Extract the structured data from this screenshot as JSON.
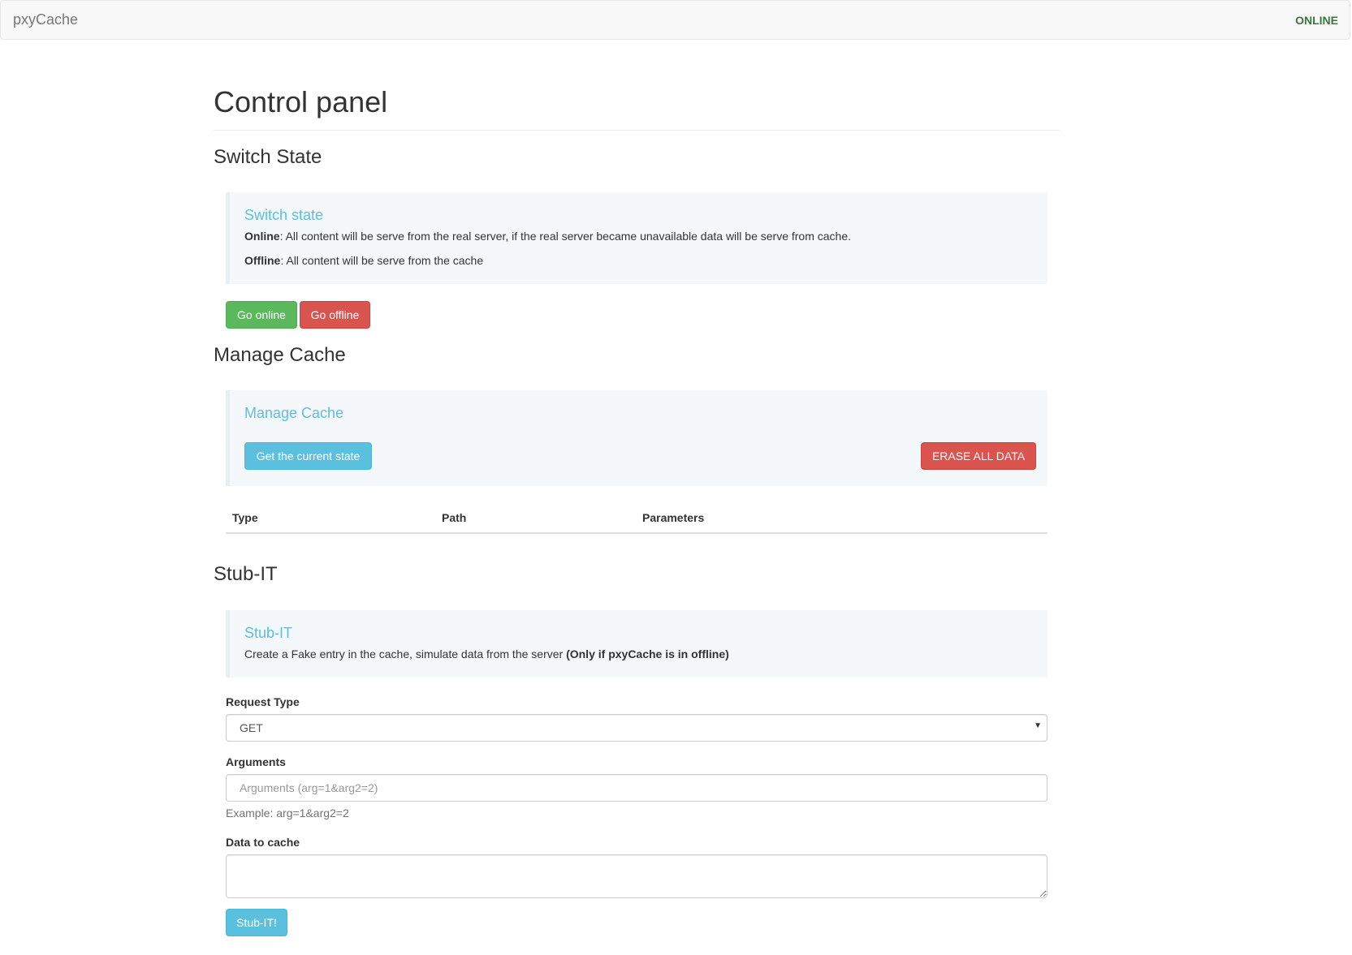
{
  "navbar": {
    "brand": "pxyCache",
    "status": "ONLINE",
    "status_color": "#3c763d"
  },
  "page": {
    "title": "Control panel"
  },
  "switch_state": {
    "heading": "Switch State",
    "callout_title": "Switch state",
    "online_label": "Online",
    "online_text": ": All content will be serve from the real server, if the real server became unavailable data will be serve from cache.",
    "offline_label": "Offline",
    "offline_text": ": All content will be serve from the cache",
    "go_online_label": "Go online",
    "go_offline_label": "Go offline"
  },
  "manage_cache": {
    "heading": "Manage Cache",
    "callout_title": "Manage Cache",
    "get_state_label": "Get the current state",
    "erase_label": "ERASE ALL DATA",
    "table": {
      "columns": [
        "Type",
        "Path",
        "Parameters"
      ],
      "rows": []
    }
  },
  "stub_it": {
    "heading": "Stub-IT",
    "callout_title": "Stub-IT",
    "description": "Create a Fake entry in the cache, simulate data from the server ",
    "description_bold": "(Only if pxyCache is in offline)",
    "request_type_label": "Request Type",
    "request_type_value": "GET",
    "arguments_label": "Arguments",
    "arguments_placeholder": "Arguments (arg=1&arg2=2)",
    "arguments_value": "",
    "arguments_help": "Example: arg=1&arg2=2",
    "data_label": "Data to cache",
    "data_value": "",
    "submit_label": "Stub-IT!"
  },
  "colors": {
    "success": "#5cb85c",
    "danger": "#d9534f",
    "info": "#5bc0de",
    "callout_bg": "#f4f8fa"
  }
}
